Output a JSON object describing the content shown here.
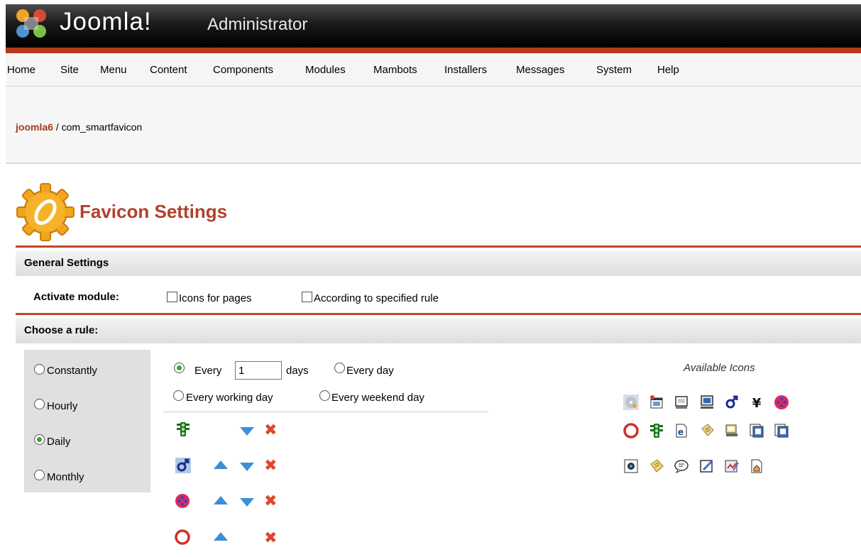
{
  "header": {
    "logo_text": "Joomla!",
    "logo_sub": "Administrator"
  },
  "menu": [
    "Home",
    "Site",
    "Menu",
    "Content",
    "Components",
    "Modules",
    "Mambots",
    "Installers",
    "Messages",
    "System",
    "Help"
  ],
  "breadcrumb": {
    "site": "joomla6",
    "sep": " / ",
    "path": "com_smartfavicon"
  },
  "page_title": "Favicon Settings",
  "general": {
    "heading": "General Settings",
    "activate_label": "Activate module:",
    "opt_pages": "Icons for pages",
    "opt_rule": "According to specified rule"
  },
  "rule": {
    "heading": "Choose a rule:",
    "options": [
      "Constantly",
      "Hourly",
      "Daily",
      "Monthly"
    ],
    "selected": "Daily",
    "every_label": "Every",
    "every_value": "1",
    "days_label": "days",
    "every_day": "Every day",
    "working_day": "Every working day",
    "weekend_day": "Every weekend day"
  },
  "available_icons_title": "Available Icons",
  "icon_names": {
    "rule_rows": [
      "traffic-light-icon",
      "male-symbol-icon",
      "blocked-circle-icon",
      "red-ring-icon"
    ],
    "available": [
      "cd-disc-icon",
      "new-window-icon",
      "monitor-icon",
      "computer-icon",
      "male-symbol-icon",
      "yen-icon",
      "blocked-circle-icon",
      "red-ring-icon",
      "traffic-light-icon",
      "ie-page-icon",
      "note-icon",
      "desktop-icon",
      "copy-page-icon",
      "copy-page-alt-icon",
      "web-cam-icon",
      "sticky-note-icon",
      "chat-bubble-icon",
      "pencil-edit-icon",
      "signature-icon",
      "home-page-icon"
    ]
  },
  "colors": {
    "accent": "#b2402a",
    "header_bar": "#b53a1b",
    "arrow": "#3b8fd6",
    "delete": "#e0462b"
  }
}
